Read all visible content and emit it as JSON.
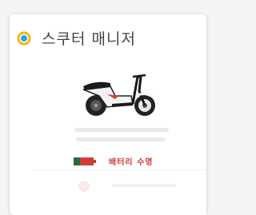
{
  "app": {
    "title": "스쿠터 매니저",
    "logo_icon": "eye-logo-icon",
    "colors": {
      "logo_ring": "#f5b400",
      "logo_center": "#2aa1e8",
      "accent_red": "#d23c37",
      "battery_green": "#1f6e3f"
    }
  },
  "vehicle": {
    "image": "scooter-image"
  },
  "battery": {
    "icon": "battery-low-icon",
    "label": "배터리 수명"
  }
}
